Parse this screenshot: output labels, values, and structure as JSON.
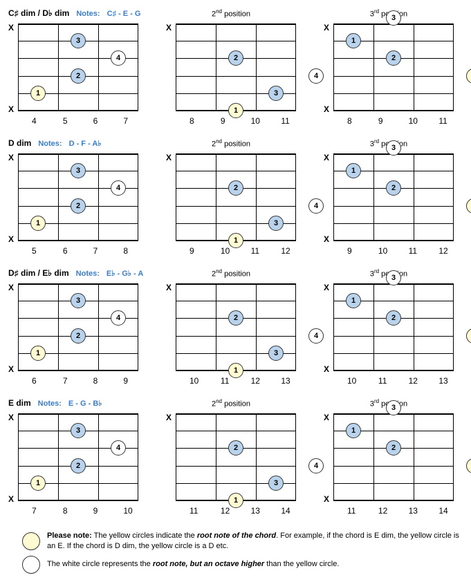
{
  "rows": [
    {
      "chord_name": "C♯ dim / D♭ dim",
      "notes": "C♯ - E - G",
      "positions": [
        {
          "header_kind": "notes",
          "muted_top": "X",
          "muted_bot": "X",
          "frets": [
            "4",
            "5",
            "6",
            "7"
          ],
          "dots": [
            {
              "fret": 1,
              "string": 4,
              "finger": "1",
              "style": "yellow"
            },
            {
              "fret": 2,
              "string": 3,
              "finger": "2",
              "style": "blue"
            },
            {
              "fret": 2,
              "string": 1,
              "finger": "3",
              "style": "blue"
            },
            {
              "fret": 3,
              "string": 2,
              "finger": "4",
              "style": "white"
            }
          ]
        },
        {
          "header_kind": "pos",
          "pos_label_html": "2<sup>nd</sup> position",
          "muted_top": "X",
          "muted_bot": "",
          "frets": [
            "8",
            "9",
            "10",
            "11"
          ],
          "dots": [
            {
              "fret": 2,
              "string": 5,
              "finger": "1",
              "style": "yellow"
            },
            {
              "fret": 2,
              "string": 2,
              "finger": "2",
              "style": "blue"
            },
            {
              "fret": 3,
              "string": 4,
              "finger": "3",
              "style": "blue"
            },
            {
              "fret": 4,
              "string": 3,
              "finger": "4",
              "style": "white"
            }
          ]
        },
        {
          "header_kind": "pos",
          "pos_label_html": "3<sup>rd</sup> position",
          "muted_top": "X",
          "muted_bot": "X",
          "edge_dot": {
            "fret": 2,
            "finger": "3"
          },
          "frets": [
            "8",
            "9",
            "10",
            "11"
          ],
          "dots": [
            {
              "fret": 1,
              "string": 1,
              "finger": "1",
              "style": "blue"
            },
            {
              "fret": 2,
              "string": 2,
              "finger": "2",
              "style": "blue"
            },
            {
              "fret": 4,
              "string": 3,
              "finger": "4",
              "style": "yellow"
            }
          ]
        }
      ]
    },
    {
      "chord_name": "D dim",
      "notes": "D - F - A♭",
      "positions": [
        {
          "header_kind": "notes",
          "muted_top": "X",
          "muted_bot": "X",
          "frets": [
            "5",
            "6",
            "7",
            "8"
          ],
          "dots": [
            {
              "fret": 1,
              "string": 4,
              "finger": "1",
              "style": "yellow"
            },
            {
              "fret": 2,
              "string": 3,
              "finger": "2",
              "style": "blue"
            },
            {
              "fret": 2,
              "string": 1,
              "finger": "3",
              "style": "blue"
            },
            {
              "fret": 3,
              "string": 2,
              "finger": "4",
              "style": "white"
            }
          ]
        },
        {
          "header_kind": "pos",
          "pos_label_html": "2<sup>nd</sup> position",
          "muted_top": "X",
          "muted_bot": "",
          "frets": [
            "9",
            "10",
            "11",
            "12"
          ],
          "dots": [
            {
              "fret": 2,
              "string": 5,
              "finger": "1",
              "style": "yellow"
            },
            {
              "fret": 2,
              "string": 2,
              "finger": "2",
              "style": "blue"
            },
            {
              "fret": 3,
              "string": 4,
              "finger": "3",
              "style": "blue"
            },
            {
              "fret": 4,
              "string": 3,
              "finger": "4",
              "style": "white"
            }
          ]
        },
        {
          "header_kind": "pos",
          "pos_label_html": "3<sup>rd</sup> position",
          "muted_top": "X",
          "muted_bot": "X",
          "edge_dot": {
            "fret": 2,
            "finger": "3"
          },
          "frets": [
            "9",
            "10",
            "11",
            "12"
          ],
          "dots": [
            {
              "fret": 1,
              "string": 1,
              "finger": "1",
              "style": "blue"
            },
            {
              "fret": 2,
              "string": 2,
              "finger": "2",
              "style": "blue"
            },
            {
              "fret": 4,
              "string": 3,
              "finger": "4",
              "style": "yellow"
            }
          ]
        }
      ]
    },
    {
      "chord_name": "D♯ dim / E♭ dim",
      "notes": "E♭ - G♭ - A",
      "positions": [
        {
          "header_kind": "notes",
          "muted_top": "X",
          "muted_bot": "X",
          "frets": [
            "6",
            "7",
            "8",
            "9"
          ],
          "dots": [
            {
              "fret": 1,
              "string": 4,
              "finger": "1",
              "style": "yellow"
            },
            {
              "fret": 2,
              "string": 3,
              "finger": "2",
              "style": "blue"
            },
            {
              "fret": 2,
              "string": 1,
              "finger": "3",
              "style": "blue"
            },
            {
              "fret": 3,
              "string": 2,
              "finger": "4",
              "style": "white"
            }
          ]
        },
        {
          "header_kind": "pos",
          "pos_label_html": "2<sup>nd</sup> position",
          "muted_top": "X",
          "muted_bot": "",
          "frets": [
            "10",
            "11",
            "12",
            "13"
          ],
          "dots": [
            {
              "fret": 2,
              "string": 5,
              "finger": "1",
              "style": "yellow"
            },
            {
              "fret": 2,
              "string": 2,
              "finger": "2",
              "style": "blue"
            },
            {
              "fret": 3,
              "string": 4,
              "finger": "3",
              "style": "blue"
            },
            {
              "fret": 4,
              "string": 3,
              "finger": "4",
              "style": "white"
            }
          ]
        },
        {
          "header_kind": "pos",
          "pos_label_html": "3<sup>rd</sup> position",
          "muted_top": "X",
          "muted_bot": "X",
          "edge_dot": {
            "fret": 2,
            "finger": "3"
          },
          "frets": [
            "10",
            "11",
            "12",
            "13"
          ],
          "dots": [
            {
              "fret": 1,
              "string": 1,
              "finger": "1",
              "style": "blue"
            },
            {
              "fret": 2,
              "string": 2,
              "finger": "2",
              "style": "blue"
            },
            {
              "fret": 4,
              "string": 3,
              "finger": "4",
              "style": "yellow"
            }
          ]
        }
      ]
    },
    {
      "chord_name": "E dim",
      "notes": "E - G - B♭",
      "positions": [
        {
          "header_kind": "notes",
          "muted_top": "X",
          "muted_bot": "X",
          "frets": [
            "7",
            "8",
            "9",
            "10"
          ],
          "dots": [
            {
              "fret": 1,
              "string": 4,
              "finger": "1",
              "style": "yellow"
            },
            {
              "fret": 2,
              "string": 3,
              "finger": "2",
              "style": "blue"
            },
            {
              "fret": 2,
              "string": 1,
              "finger": "3",
              "style": "blue"
            },
            {
              "fret": 3,
              "string": 2,
              "finger": "4",
              "style": "white"
            }
          ]
        },
        {
          "header_kind": "pos",
          "pos_label_html": "2<sup>nd</sup> position",
          "muted_top": "X",
          "muted_bot": "",
          "frets": [
            "11",
            "12",
            "13",
            "14"
          ],
          "dots": [
            {
              "fret": 2,
              "string": 5,
              "finger": "1",
              "style": "yellow"
            },
            {
              "fret": 2,
              "string": 2,
              "finger": "2",
              "style": "blue"
            },
            {
              "fret": 3,
              "string": 4,
              "finger": "3",
              "style": "blue"
            },
            {
              "fret": 4,
              "string": 3,
              "finger": "4",
              "style": "white"
            }
          ]
        },
        {
          "header_kind": "pos",
          "pos_label_html": "3<sup>rd</sup> position",
          "muted_top": "X",
          "muted_bot": "X",
          "edge_dot": {
            "fret": 2,
            "finger": "3"
          },
          "frets": [
            "11",
            "12",
            "13",
            "14"
          ],
          "dots": [
            {
              "fret": 1,
              "string": 1,
              "finger": "1",
              "style": "blue"
            },
            {
              "fret": 2,
              "string": 2,
              "finger": "2",
              "style": "blue"
            },
            {
              "fret": 4,
              "string": 3,
              "finger": "4",
              "style": "yellow"
            }
          ]
        }
      ]
    }
  ],
  "legend": {
    "note_label": "Please note:",
    "line1_a": "The yellow circles indicate the ",
    "line1_em": "root note of the chord",
    "line1_b": ". For example, if the chord is E dim, the yellow circle is an E.  If the chord is D dim, the yellow circle is a D etc.",
    "line2_a": "The white circle represents the ",
    "line2_em": "root note, but an octave higher",
    "line2_b": " than the yellow circle."
  },
  "labels": {
    "notes_prefix": "Notes:"
  }
}
